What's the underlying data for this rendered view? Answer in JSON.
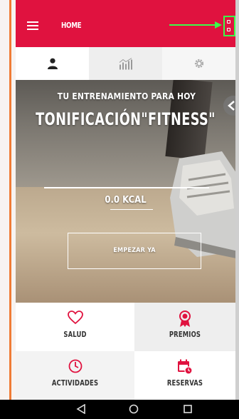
{
  "header": {
    "title": "HOME",
    "menu_icon": "hamburger-menu-icon",
    "grid_icon": "grid-view-icon"
  },
  "tabs": [
    {
      "name": "profile",
      "icon": "person-icon"
    },
    {
      "name": "stats",
      "icon": "chart-icon"
    },
    {
      "name": "settings",
      "icon": "gear-icon"
    }
  ],
  "hero": {
    "subtitle": "TU ENTRENAMIENTO PARA HOY",
    "title": "TONIFICACIÓN\"FITNESS\"",
    "kcal": "0.0 KCAL",
    "start_button": "EMPEZAR YA"
  },
  "tiles": [
    {
      "label": "SALUD",
      "icon": "heart-icon"
    },
    {
      "label": "PREMIOS",
      "icon": "medal-icon"
    },
    {
      "label": "ACTIVIDADES",
      "icon": "clock-icon"
    },
    {
      "label": "RESERVAS",
      "icon": "calendar-icon"
    }
  ],
  "colors": {
    "brand": "#e0123f",
    "highlight": "#3aff4a"
  }
}
